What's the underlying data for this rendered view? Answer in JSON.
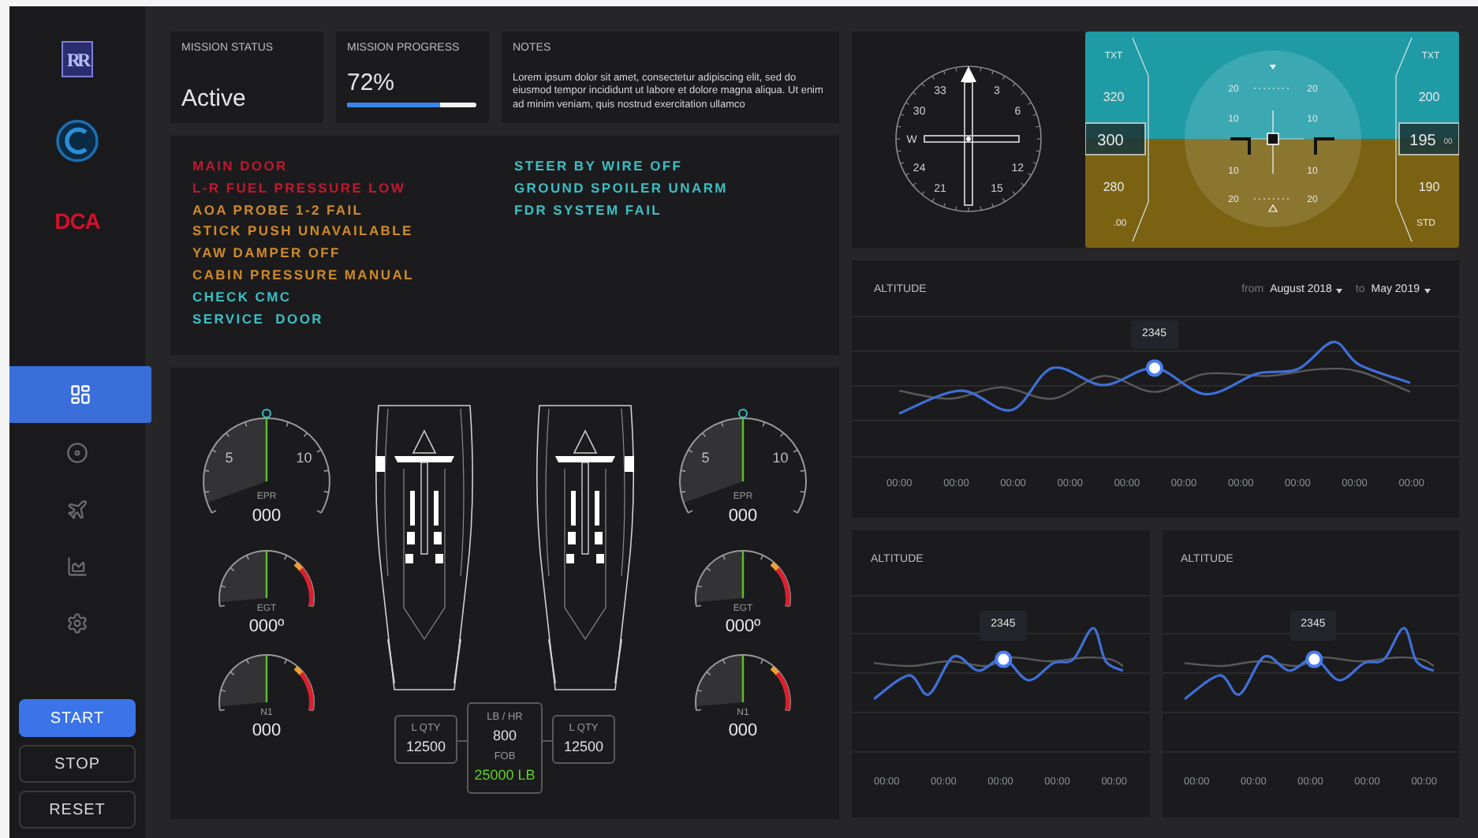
{
  "sidebar": {
    "logos": [
      {
        "kind": "monogram",
        "text": "RR"
      },
      {
        "kind": "ring"
      },
      {
        "kind": "wordmark",
        "text": "DCA"
      }
    ],
    "nav": [
      {
        "kind": "dashboard",
        "selected": true
      },
      {
        "kind": "disc",
        "selected": false
      },
      {
        "kind": "plane",
        "selected": false
      },
      {
        "kind": "chart",
        "selected": false
      },
      {
        "kind": "settings",
        "selected": false
      }
    ],
    "buttons": [
      {
        "label": "START",
        "primary": true
      },
      {
        "label": "STOP",
        "primary": false
      },
      {
        "label": "RESET",
        "primary": false
      }
    ]
  },
  "mission_status": {
    "label": "MISSION STATUS",
    "value": "Active"
  },
  "mission_progress": {
    "label": "MISSION PROGRESS",
    "value": "72%",
    "level": 0.72
  },
  "notes": {
    "label": "NOTES",
    "text": "Lorem ipsum dolor sit amet, consectetur adipiscing elit, sed do eiusmod tempor incididunt ut labore et dolore magna aliqua. Ut enim ad minim veniam, quis nostrud exercitation ullamco"
  },
  "alerts": {
    "columns": [
      [
        {
          "text": "MAIN DOOR",
          "color": "#c0182f"
        },
        {
          "text": "L-R FUEL PRESSURE LOW",
          "color": "#c0182f"
        },
        {
          "text": "AOA PROBE 1-2 FAIL",
          "color": "#d08a28"
        },
        {
          "text": "STICK PUSH UNAVAILABLE",
          "color": "#d08a28"
        },
        {
          "text": "YAW DAMPER OFF",
          "color": "#d08a28"
        },
        {
          "text": "CABIN PRESSURE MANUAL",
          "color": "#d08a28"
        },
        {
          "text": "CHECK CMC",
          "color": "#3cbfc4"
        },
        {
          "text": "SERVICE  DOOR",
          "color": "#3cbfc4"
        }
      ],
      [
        {
          "text": "STEER BY WIRE OFF",
          "color": "#3cbfc4"
        },
        {
          "text": "GROUND SPOILER UNARM",
          "color": "#3cbfc4"
        },
        {
          "text": "FDR SYSTEM FAIL",
          "color": "#3cbfc4"
        }
      ]
    ]
  },
  "engines": {
    "left_gauges": [
      {
        "kind": "large",
        "label": "EPR",
        "value": "000",
        "ticks": [
          "5",
          "10"
        ]
      },
      {
        "kind": "small",
        "label": "EGT",
        "value": "000º"
      },
      {
        "kind": "small",
        "label": "N1",
        "value": "000"
      }
    ],
    "right_gauges": [
      {
        "kind": "large",
        "label": "EPR",
        "value": "000",
        "ticks": [
          "5",
          "10"
        ]
      },
      {
        "kind": "small",
        "label": "EGT",
        "value": "000º"
      },
      {
        "kind": "small",
        "label": "N1",
        "value": "000"
      }
    ],
    "fuel": {
      "left": {
        "label": "L QTY",
        "value": "12500"
      },
      "center": {
        "flow_label": "LB / HR",
        "flow_value": "800",
        "fob_label": "FOB",
        "fob_value": "25000 LB"
      },
      "right": {
        "label": "L QTY",
        "value": "12500"
      }
    }
  },
  "compass": {
    "labels": [
      "33",
      "3",
      "6",
      "12",
      "15",
      "21",
      "24",
      "W",
      "30"
    ]
  },
  "attitude": {
    "speed": {
      "top_label": "TXT",
      "upper": "320",
      "current": "300",
      "lower": "280",
      "bottom_label": ".00"
    },
    "pitch": [
      "20",
      "20",
      "10",
      "10",
      "10",
      "10",
      "20",
      "20"
    ],
    "altitude": {
      "top_label": "TXT",
      "upper": "200",
      "current": "195",
      "current_small": "00",
      "lower": "190",
      "bottom_label": "STD"
    }
  },
  "altitude_chart": {
    "title": "ALTITUDE",
    "from_label": "from",
    "from_value": "August 2018",
    "to_label": "to",
    "to_value": "May 2019",
    "tooltip": "2345",
    "x_labels": [
      "00:00",
      "00:00",
      "00:00",
      "00:00",
      "00:00",
      "00:00",
      "00:00",
      "00:00",
      "00:00",
      "00:00"
    ]
  },
  "small_charts": [
    {
      "title": "ALTITUDE",
      "tooltip": "2345",
      "x_labels": [
        "00:00",
        "00:00",
        "00:00",
        "00:00",
        "00:00"
      ]
    },
    {
      "title": "ALTITUDE",
      "tooltip": "2345",
      "x_labels": [
        "00:00",
        "00:00",
        "00:00",
        "00:00",
        "00:00"
      ]
    }
  ]
}
